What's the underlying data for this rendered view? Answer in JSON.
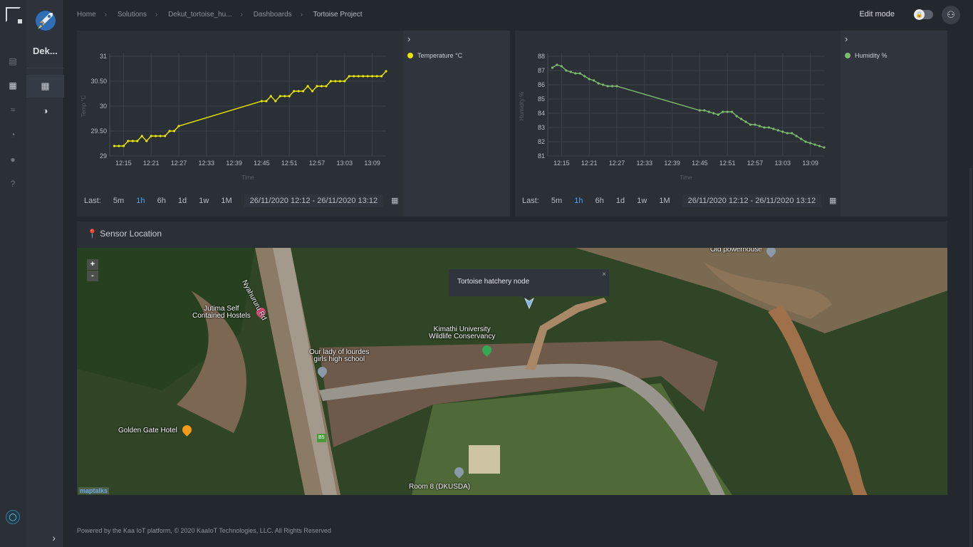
{
  "breadcrumb": [
    "Home",
    "Solutions",
    "Dekut_tortoise_hu...",
    "Dashboards",
    "Tortoise Project"
  ],
  "header": {
    "edit_mode_label": "Edit mode"
  },
  "sidebar": {
    "title": "Dek..."
  },
  "temperature_chart": {
    "legend": "Temperature °C",
    "y_label": "Temp °C",
    "x_label": "Time",
    "y_ticks": [
      "31",
      "30.50",
      "30",
      "29.50",
      "29"
    ],
    "x_ticks": [
      "12:15",
      "12:21",
      "12:27",
      "12:33",
      "12:39",
      "12:45",
      "12:51",
      "12:57",
      "13:03",
      "13:09"
    ],
    "timebar": {
      "last_label": "Last:",
      "options": [
        "5m",
        "1h",
        "6h",
        "1d",
        "1w",
        "1M"
      ],
      "active": "1h",
      "range": "26/11/2020 12:12 - 26/11/2020 13:12"
    }
  },
  "humidity_chart": {
    "legend": "Humidity %",
    "y_label": "Humidity %",
    "x_label": "Time",
    "y_ticks": [
      "88",
      "87",
      "86",
      "85",
      "84",
      "83",
      "82",
      "81"
    ],
    "x_ticks": [
      "12:15",
      "12:21",
      "12:27",
      "12:33",
      "12:39",
      "12:45",
      "12:51",
      "12:57",
      "13:03",
      "13:09"
    ],
    "timebar": {
      "last_label": "Last:",
      "options": [
        "5m",
        "1h",
        "6h",
        "1d",
        "1w",
        "1M"
      ],
      "active": "1h",
      "range": "26/11/2020 12:12 - 26/11/2020 13:12"
    }
  },
  "chart_data": [
    {
      "type": "line",
      "title": "",
      "xlabel": "Time",
      "ylabel": "Temp °C",
      "ylim": [
        29,
        31
      ],
      "series": [
        {
          "name": "Temperature °C",
          "color": "#e6e600",
          "x": [
            "12:13",
            "12:14",
            "12:15",
            "12:16",
            "12:17",
            "12:18",
            "12:19",
            "12:20",
            "12:21",
            "12:22",
            "12:23",
            "12:24",
            "12:25",
            "12:26",
            "12:27",
            "12:45",
            "12:46",
            "12:47",
            "12:48",
            "12:49",
            "12:50",
            "12:51",
            "12:52",
            "12:53",
            "12:54",
            "12:55",
            "12:56",
            "12:57",
            "12:58",
            "12:59",
            "13:00",
            "13:01",
            "13:02",
            "13:03",
            "13:04",
            "13:05",
            "13:06",
            "13:07",
            "13:08",
            "13:09",
            "13:10",
            "13:11",
            "13:12"
          ],
          "values": [
            29.2,
            29.2,
            29.2,
            29.3,
            29.3,
            29.3,
            29.4,
            29.3,
            29.4,
            29.4,
            29.4,
            29.4,
            29.5,
            29.5,
            29.6,
            30.1,
            30.1,
            30.2,
            30.1,
            30.2,
            30.2,
            30.2,
            30.3,
            30.3,
            30.3,
            30.4,
            30.3,
            30.4,
            30.4,
            30.4,
            30.5,
            30.5,
            30.5,
            30.5,
            30.6,
            30.6,
            30.6,
            30.6,
            30.6,
            30.6,
            30.6,
            30.6,
            30.7
          ]
        }
      ]
    },
    {
      "type": "line",
      "title": "",
      "xlabel": "Time",
      "ylabel": "Humidity %",
      "ylim": [
        81,
        88
      ],
      "series": [
        {
          "name": "Humidity %",
          "color": "#7cba6e",
          "x": [
            "12:13",
            "12:14",
            "12:15",
            "12:16",
            "12:17",
            "12:18",
            "12:19",
            "12:20",
            "12:21",
            "12:22",
            "12:23",
            "12:24",
            "12:25",
            "12:26",
            "12:27",
            "12:45",
            "12:46",
            "12:47",
            "12:48",
            "12:49",
            "12:50",
            "12:51",
            "12:52",
            "12:53",
            "12:54",
            "12:55",
            "12:56",
            "12:57",
            "12:58",
            "12:59",
            "13:00",
            "13:01",
            "13:02",
            "13:03",
            "13:04",
            "13:05",
            "13:06",
            "13:07",
            "13:08",
            "13:09",
            "13:10",
            "13:11",
            "13:12"
          ],
          "values": [
            87.2,
            87.4,
            87.3,
            87.0,
            86.9,
            86.8,
            86.8,
            86.6,
            86.4,
            86.3,
            86.1,
            86.0,
            85.9,
            85.9,
            85.9,
            84.2,
            84.2,
            84.1,
            84.0,
            83.9,
            84.1,
            84.1,
            84.1,
            83.8,
            83.6,
            83.4,
            83.2,
            83.2,
            83.1,
            83.0,
            83.0,
            82.9,
            82.8,
            82.7,
            82.6,
            82.6,
            82.4,
            82.2,
            82.0,
            81.9,
            81.8,
            81.7,
            81.6
          ]
        }
      ]
    }
  ],
  "map": {
    "header": "Sensor Location",
    "zoom_in": "+",
    "zoom_out": "-",
    "popup_text": "Tortoise hatchery node",
    "popup_close": "×",
    "attribution": "maptalks",
    "places": {
      "jutima": "Jutima Self\nContained Hostels",
      "nyahururu": "Nyahururu Rd",
      "kimathi": "Kimathi University\nWildlife Conservancy",
      "lourdes": "Our lady of lourdes\ngirls high school",
      "golden_gate": "Golden Gate Hotel",
      "old_powerhouse": "Old powerhouse",
      "room8": "Room 8 (DKUSDA)",
      "b5": "B5"
    }
  },
  "footer": "Powered by the Kaa IoT platform, © 2020 KaaIoT Technologies, LLC. All Rights Reserved"
}
